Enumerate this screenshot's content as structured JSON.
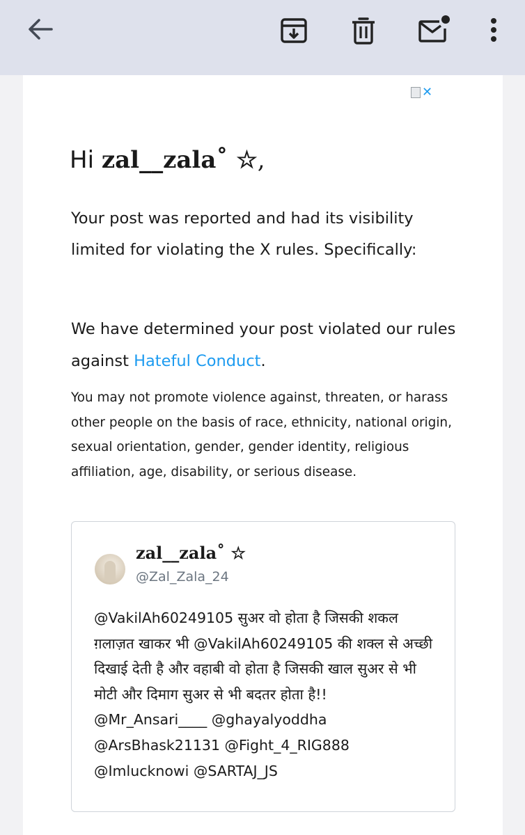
{
  "toolbar": {
    "back_icon": "arrow-back-icon",
    "archive_icon": "archive-icon",
    "delete_icon": "trash-icon",
    "mark_unread_icon": "mark-unread-icon",
    "more_icon": "more-vert-icon",
    "background": "#dee1ec"
  },
  "email": {
    "broken_image_icon": "broken-image-x-logo",
    "greeting_prefix": "Hi",
    "greeting_name": "zal__zala˚ ☆",
    "greeting_suffix": ",",
    "para1": "Your post was reported and had its visibility limited for violating the X rules. Specifically:",
    "para2_before": "We have determined your post violated our rules against ",
    "para2_link": "Hateful Conduct",
    "para2_after": ".",
    "para3": "You may not promote violence against, threaten, or harass other people on the basis of race, ethnicity, national origin, sexual orientation, gender, gender identity, religious affiliation, age, disability, or serious disease.",
    "link_color": "#1d9bf0"
  },
  "tweet": {
    "display_name": "zal__zala˚ ☆",
    "handle": "@Zal_Zala_24",
    "text": "@VakilAh60249105 सुअर वो होता है जिसकी शकल ग़लाज़त खाकर भी @VakilAh60249105 की शक्ल से अच्छी दिखाई देती है और वहाबी वो होता है जिसकी खाल सुअर से भी मोटी और दिमाग सुअर से भी बदतर होता है!! @Mr_Ansari____ @ghayalyoddha @ArsBhask21131 @Fight_4_RIG888 @Imlucknowi @SARTAJ_JS"
  }
}
